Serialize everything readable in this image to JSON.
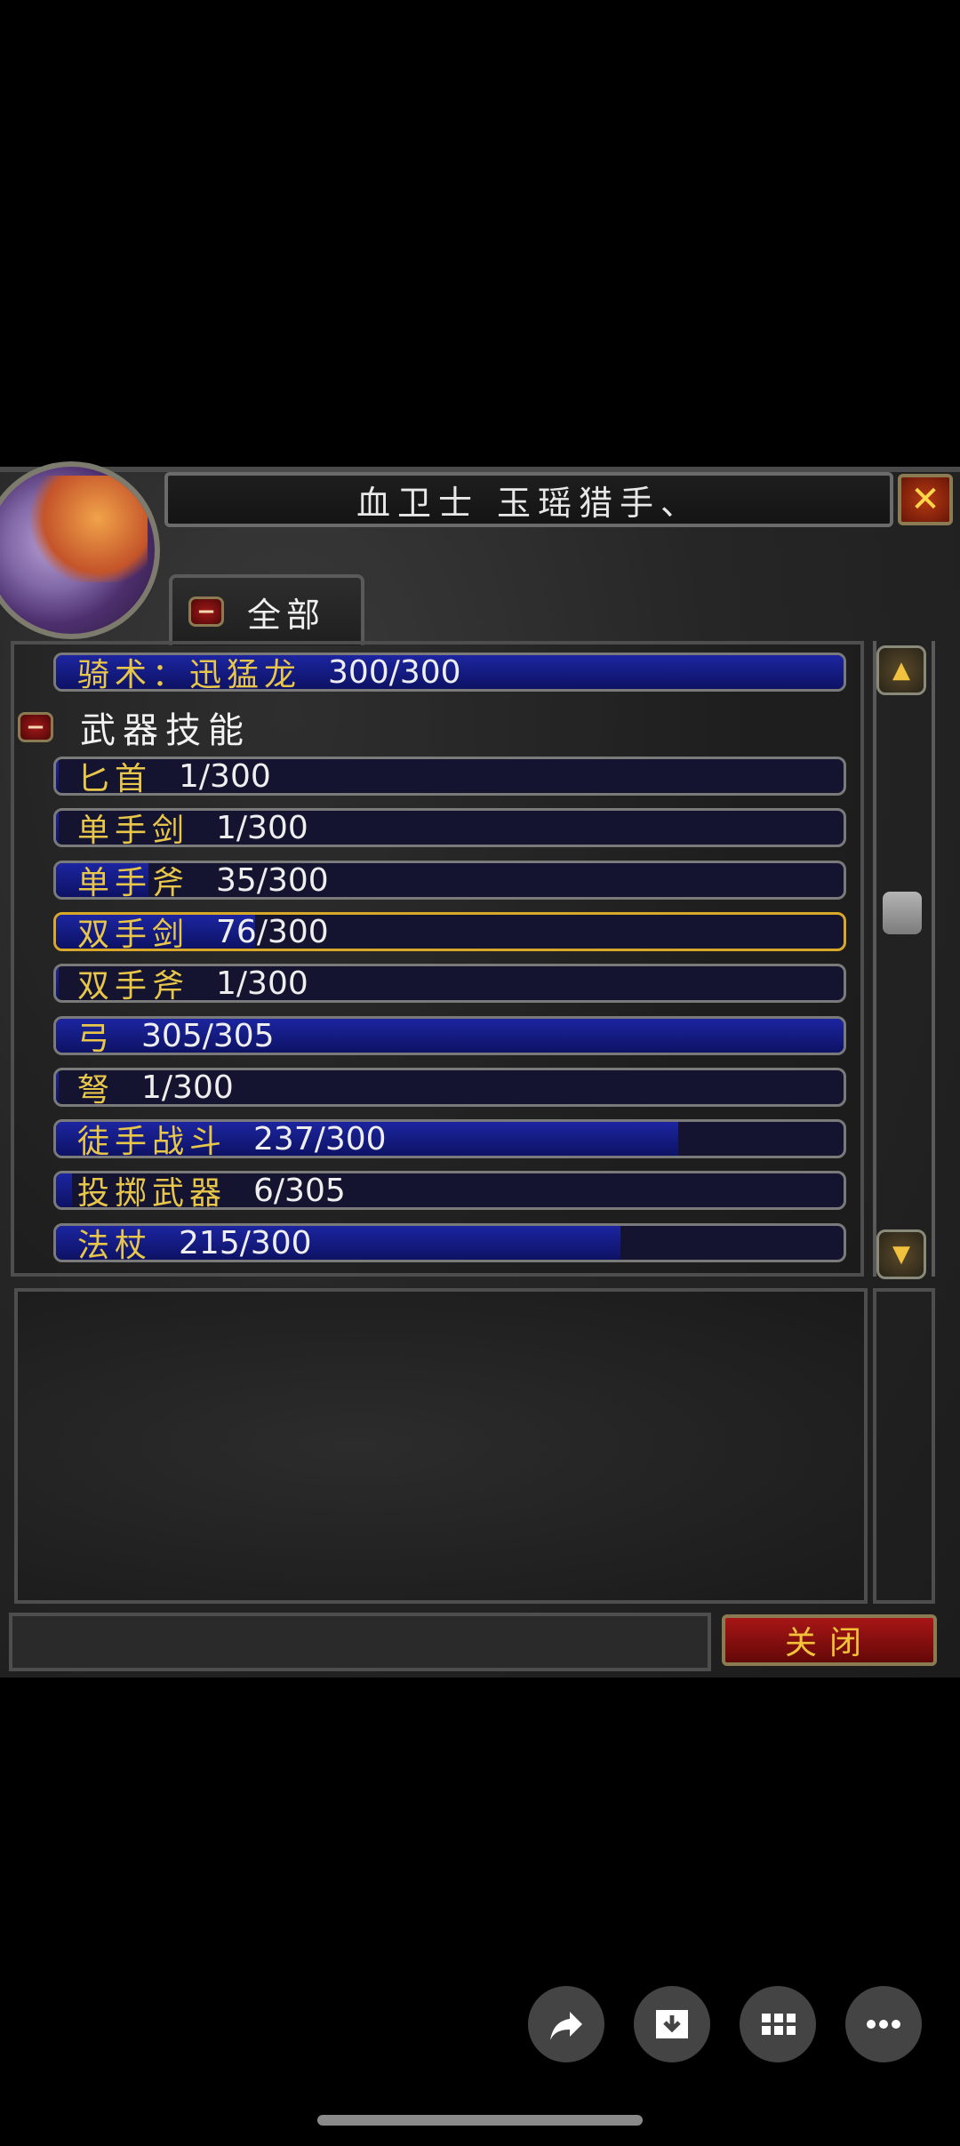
{
  "header": {
    "title": "血卫士 玉瑶猎手、",
    "close_icon_label": "✕"
  },
  "filter": {
    "label": "全部"
  },
  "skills_top": {
    "name": "骑术：迅猛龙",
    "value": "300/300",
    "progress": 1.0
  },
  "category": {
    "label": "武器技能"
  },
  "skills": [
    {
      "name": "匕首",
      "value": "1/300",
      "progress": 0.003
    },
    {
      "name": "单手剑",
      "value": "1/300",
      "progress": 0.003
    },
    {
      "name": "单手斧",
      "value": "35/300",
      "progress": 0.117
    },
    {
      "name": "双手剑",
      "value": "76/300",
      "progress": 0.253
    },
    {
      "name": "双手斧",
      "value": "1/300",
      "progress": 0.003
    },
    {
      "name": "弓",
      "value": "305/305",
      "progress": 1.0
    },
    {
      "name": "弩",
      "value": "1/300",
      "progress": 0.003
    },
    {
      "name": "徒手战斗",
      "value": "237/300",
      "progress": 0.79
    },
    {
      "name": "投掷武器",
      "value": "6/305",
      "progress": 0.02
    },
    {
      "name": "法杖",
      "value": "215/300",
      "progress": 0.717
    }
  ],
  "footer": {
    "close_label": "关闭"
  },
  "icons": {
    "share": "share-icon",
    "download": "download-icon",
    "apps": "apps-icon",
    "more": "more-icon"
  },
  "colors": {
    "bar_fill": "#1c25a0",
    "skill_name": "#e7c64a",
    "selected_border": "#d8a928",
    "close_button": "#a81616"
  }
}
